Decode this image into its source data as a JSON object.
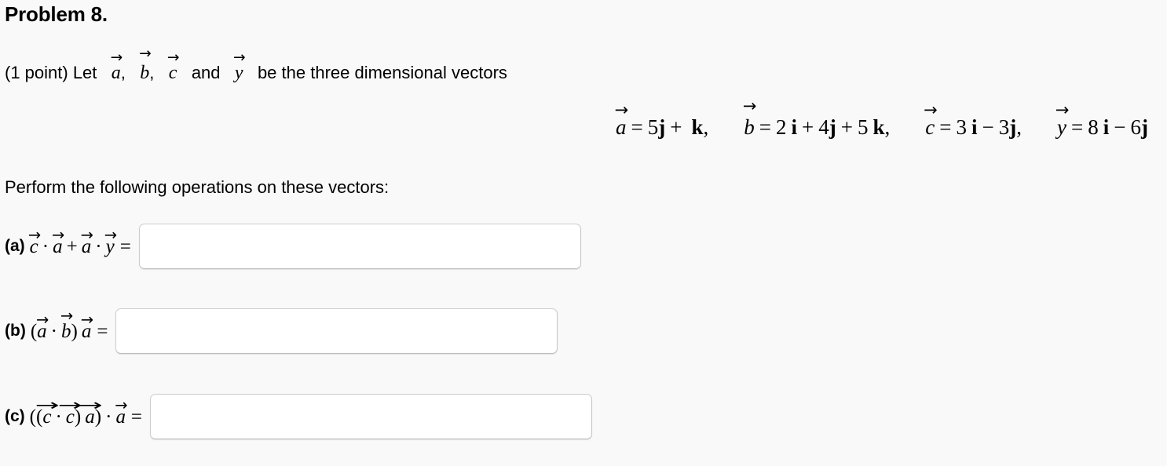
{
  "problem": {
    "title": "Problem 8.",
    "points_prefix": "(1 point) Let",
    "intro_mid_1": ",",
    "intro_mid_2": ",",
    "intro_and": "and",
    "intro_tail": "be the three dimensional vectors",
    "vector_names": [
      "a",
      "b",
      "c",
      "y"
    ],
    "instruction": "Perform the following operations on these vectors:"
  },
  "definitions": {
    "a": {
      "name": "a",
      "eq": "=",
      "terms": "5 j +  k,",
      "coef_j": 5,
      "coef_k": 1
    },
    "b": {
      "name": "b",
      "eq": "=",
      "terms": "2 i + 4 j + 5 k,",
      "coef_i": 2,
      "coef_j": 4,
      "coef_k": 5
    },
    "c": {
      "name": "c",
      "eq": "=",
      "terms": "3 i - 3 j,",
      "coef_i": 3,
      "coef_j": -3
    },
    "y": {
      "name": "y",
      "eq": "=",
      "terms": "8 i - 6 j",
      "coef_i": 8,
      "coef_j": -6
    },
    "symbols": {
      "equals": "=",
      "plus": "+",
      "minus": "−",
      "comma": ",",
      "i": "i",
      "j": "j",
      "k": "k",
      "n5": "5",
      "n1": "",
      "n2": "2",
      "n4": "4",
      "n5b": "5",
      "n3": "3",
      "n3b": "3",
      "n8": "8",
      "n6": "6"
    }
  },
  "parts": {
    "a": {
      "label": "(a)",
      "expression": "c⃗ · a⃗ + a⃗ · y⃗ =",
      "tokens": {
        "v1": "c",
        "dot1": "·",
        "v2": "a",
        "plus": "+",
        "v3": "a",
        "dot2": "·",
        "v4": "y",
        "equals": "="
      },
      "input_value": "",
      "input_placeholder": ""
    },
    "b": {
      "label": "(b)",
      "expression": "(a⃗ · b⃗) a⃗ =",
      "tokens": {
        "open": "(",
        "v1": "a",
        "dot1": "·",
        "v2": "b",
        "close": ")",
        "v3": "a",
        "equals": "="
      },
      "input_value": "",
      "input_placeholder": ""
    },
    "c": {
      "label": "(c)",
      "expression": "((c⃗ · c⃗) a⃗) · a⃗ =",
      "tokens": {
        "open1": "(",
        "open2": "(",
        "v1": "c",
        "dot1": "·",
        "v2": "c",
        "close1": ")",
        "v3": "a",
        "close2": ")",
        "dot2": "·",
        "v4": "a",
        "equals": "="
      },
      "input_value": "",
      "input_placeholder": ""
    }
  },
  "glyphs": {
    "arrow": "⃗",
    "arrow_glyph": "→",
    "cdot": "·",
    "minus": "−"
  },
  "colors": {
    "background": "#f9f9f9",
    "text": "#000000",
    "input_background": "#ffffff",
    "input_border": "#cdcdcd"
  }
}
